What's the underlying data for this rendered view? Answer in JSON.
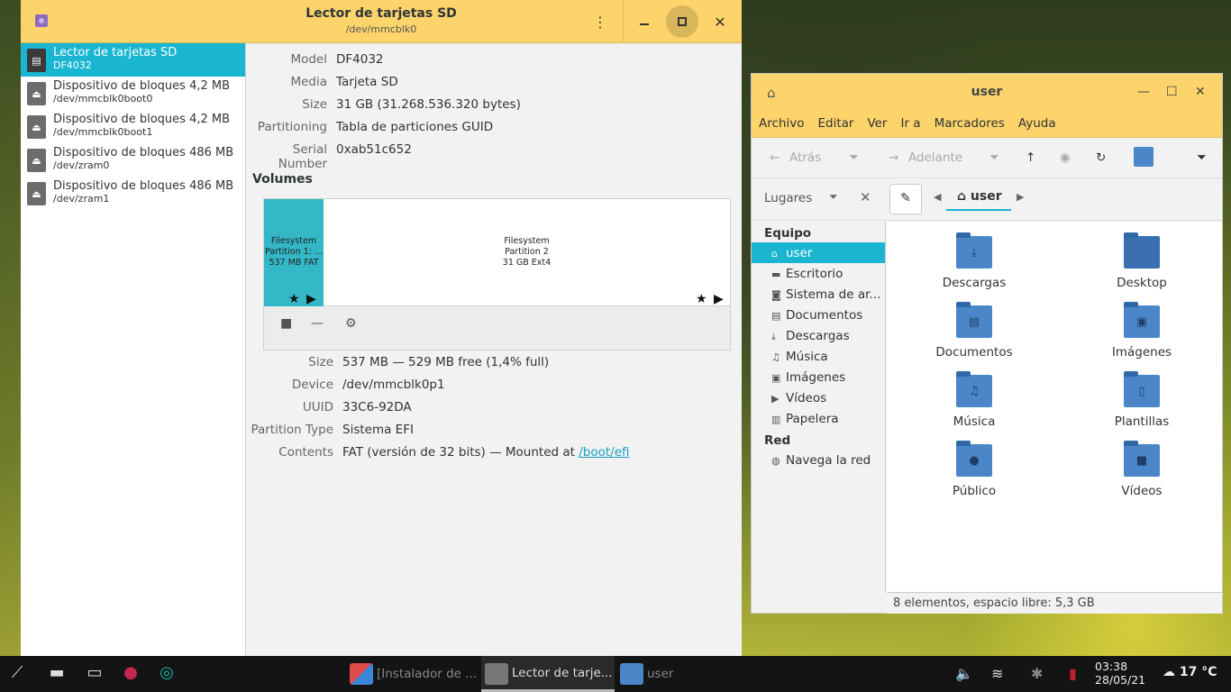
{
  "disks": {
    "title": "Lector de tarjetas SD",
    "subtitle": "/dev/mmcblk0",
    "menu_glyph": "⋮",
    "close_glyph": "✕",
    "devices": [
      {
        "name": "Lector de tarjetas SD",
        "sub": "DF4032",
        "icon": "sd-card-icon"
      },
      {
        "name": "Dispositivo de bloques 4,2 MB",
        "sub": "/dev/mmcblk0boot0",
        "icon": "eject-icon"
      },
      {
        "name": "Dispositivo de bloques 4,2 MB",
        "sub": "/dev/mmcblk0boot1",
        "icon": "eject-icon"
      },
      {
        "name": "Dispositivo de bloques 486 MB",
        "sub": "/dev/zram0",
        "icon": "eject-icon"
      },
      {
        "name": "Dispositivo de bloques 486 MB",
        "sub": "/dev/zram1",
        "icon": "eject-icon"
      }
    ],
    "info": {
      "model_k": "Model",
      "model_v": "DF4032",
      "media_k": "Media",
      "media_v": "Tarjeta SD",
      "size_k": "Size",
      "size_v": "31 GB (31.268.536.320 bytes)",
      "part_k": "Partitioning",
      "part_v": "Tabla de particiones GUID",
      "serial_k": "Serial Number",
      "serial_v": "0xab51c652"
    },
    "volumes_heading": "Volumes",
    "partition1": {
      "l1": "Filesystem",
      "l2": "Partition 1: ...",
      "l3": "537 MB FAT"
    },
    "partition2": {
      "l1": "Filesystem",
      "l2": "Partition 2",
      "l3": "31 GB Ext4"
    },
    "vol_glyphs": {
      "star": "★",
      "play": "▶",
      "stop": "■",
      "minus": "—",
      "gears": "⚙"
    },
    "detail": {
      "size_k": "Size",
      "size_v": "537 MB — 529 MB free (1,4% full)",
      "device_k": "Device",
      "device_v": "/dev/mmcblk0p1",
      "uuid_k": "UUID",
      "uuid_v": "33C6-92DA",
      "ptype_k": "Partition Type",
      "ptype_v": "Sistema EFI",
      "contents_k": "Contents",
      "contents_v": "FAT (versión de 32 bits) — Mounted at ",
      "mount_link": "/boot/efi"
    }
  },
  "fm": {
    "title": "user",
    "window_glyphs": {
      "home": "⌂",
      "min": "—",
      "max": "☐",
      "close": "✕"
    },
    "menu": [
      "Archivo",
      "Editar",
      "Ver",
      "Ir a",
      "Marcadores",
      "Ayuda"
    ],
    "back": "Atrás",
    "forward": "Adelante",
    "nav_glyphs": {
      "back": "←",
      "forward": "→",
      "drop": "⏷",
      "up": "↑",
      "stop": "◉",
      "reload": "↻",
      "pen": "✎",
      "left": "◀",
      "right": "▶"
    },
    "places_label": "Lugares",
    "places_close": "✕",
    "breadcrumb": "⌂ user",
    "sidebar": {
      "equipo": "Equipo",
      "red": "Red",
      "items": [
        {
          "label": "user",
          "glyph": "⌂"
        },
        {
          "label": "Escritorio",
          "glyph": "▬"
        },
        {
          "label": "Sistema de ar...",
          "glyph": "◙"
        },
        {
          "label": "Documentos",
          "glyph": "▤"
        },
        {
          "label": "Descargas",
          "glyph": "⤓"
        },
        {
          "label": "Música",
          "glyph": "♫"
        },
        {
          "label": "Imágenes",
          "glyph": "▣"
        },
        {
          "label": "Vídeos",
          "glyph": "▶"
        },
        {
          "label": "Papelera",
          "glyph": "▥"
        }
      ],
      "network_item": {
        "label": "Navega la red",
        "glyph": "◍"
      }
    },
    "files": [
      {
        "label": "Descargas",
        "glyph": "⤓"
      },
      {
        "label": "Desktop",
        "glyph": ""
      },
      {
        "label": "Documentos",
        "glyph": "▤"
      },
      {
        "label": "Imágenes",
        "glyph": "▣"
      },
      {
        "label": "Música",
        "glyph": "♫"
      },
      {
        "label": "Plantillas",
        "glyph": "▯"
      },
      {
        "label": "Público",
        "glyph": "●"
      },
      {
        "label": "Vídeos",
        "glyph": "■"
      }
    ],
    "status": "8 elementos, espacio libre: 5,3 GB"
  },
  "taskbar": {
    "tasks": [
      {
        "label": "[Instalador de ...",
        "color": "#d03f3f"
      },
      {
        "label": "Lector de tarje...",
        "color": "#777777"
      },
      {
        "label": "user",
        "color": "#4a86c8"
      }
    ],
    "launcher_glyphs": {
      "start": "⟋",
      "files": "▬",
      "window": "▭",
      "raspberry": "●",
      "camera": "◎"
    },
    "tray_glyphs": {
      "volume": "🔈",
      "wifi": "≋",
      "bluetooth": "✱",
      "battery": "▮"
    },
    "time": "03:38",
    "date": "28/05/21",
    "weather": "☁ 17 °C"
  }
}
